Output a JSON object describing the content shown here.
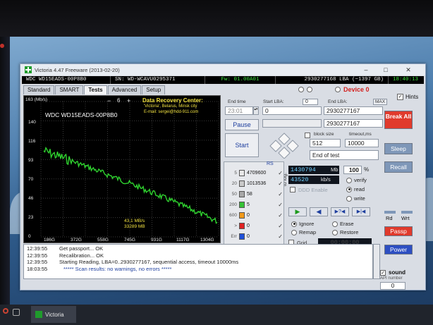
{
  "window": {
    "title": "Victoria 4.47 Freeware (2013-02-20)",
    "controls": {
      "minimize": "–",
      "maximize": "□",
      "close": "✕"
    }
  },
  "infobar": {
    "model": "WDC WD15EADS-00P8B0",
    "serial": "SN: WD-WCAVU0295371",
    "firmware": "Fw: 01.00A01",
    "lba": "2930277168 LBA (~1397 GB)",
    "time": "18:40:13"
  },
  "tabs": [
    "Standard",
    "SMART",
    "Tests",
    "Advanced",
    "Setup"
  ],
  "graph": {
    "ylabel": "163 (Mb/s)",
    "yticks": [
      "140",
      "116",
      "93",
      "70",
      "46",
      "23",
      "0"
    ],
    "xticks": [
      "186G",
      "372G",
      "558G",
      "745G",
      "931G",
      "1117G",
      "1304G"
    ],
    "minus": "−",
    "step": "6",
    "plus": "+",
    "drive_label": "WDC WD15EADS-00P8B0",
    "drc_title": "Data Recovery Center:",
    "drc_line1": "'Victoria', Belarus, Minsk city",
    "drc_line2": "E-mail: sergei@hdd-911.com",
    "speed_label": "43,1 MB/s",
    "position_label": "33289 MB",
    "line_color": "#2fd22f"
  },
  "controls": {
    "end_time_label": "End time",
    "end_time_value": "23:01",
    "start_lba_label": "Start LBA:",
    "start_lba_value": "0",
    "start_lba_small": "0",
    "end_lba_label": "End LBA:",
    "end_lba_max": "MAX",
    "end_lba_value": "2930277167",
    "current_lba_value": "2930277167",
    "pause_label": "Pause",
    "start_label": "Start",
    "block_size_label": "block size",
    "block_size_value": "512",
    "timeout_label": "timeout,ms",
    "timeout_value": "10000",
    "end_action": "End of test",
    "device_label": "Device 0",
    "hints_label": "Hints",
    "scanned_mb": "1430794",
    "scanned_unit": "Mb",
    "percent": "100",
    "percent_unit": "%",
    "speed_value": "43520",
    "speed_unit": "kb/s",
    "to_log": "to log:",
    "ddd_label": "DDD Enable",
    "mode_verify": "verify",
    "mode_read": "read",
    "mode_write": "write",
    "act_ignore": "Ignore",
    "act_erase": "Erase",
    "act_remap": "Remap",
    "act_restore": "Restore",
    "grid_label": "Grid",
    "grid_timer": "00:00:00",
    "rs_label": "RS"
  },
  "rs_stats": [
    {
      "label": "5",
      "count": "4709600",
      "color": "#e8e8e8"
    },
    {
      "label": "20",
      "count": "1013536",
      "color": "#c9c9c9"
    },
    {
      "label": "50",
      "count": "58",
      "color": "#a8a8a8"
    },
    {
      "label": "200",
      "count": "5",
      "color": "#36c236"
    },
    {
      "label": "600",
      "count": "0",
      "color": "#f19a1b"
    },
    {
      "label": ">",
      "count": "0",
      "color": "#e02323"
    },
    {
      "label": "Err",
      "count": "0",
      "color": "#2050d8"
    }
  ],
  "right_panel": {
    "break_all": "Break All",
    "sleep": "Sleep",
    "recall": "Recall",
    "rd": "Rd",
    "wrt": "Wrt",
    "passp": "Passp",
    "power": "Power",
    "sound": "sound",
    "api_number": "API number",
    "api_value": "0"
  },
  "log": [
    {
      "time": "12:39:55",
      "msg": "Get passport... OK"
    },
    {
      "time": "12:39:55",
      "msg": "Recalibration... OK"
    },
    {
      "time": "12:39:55",
      "msg": "Starting Reading, LBA=0..2930277167, sequential access, timeout 10000ms"
    },
    {
      "time": "18:03:55",
      "msg": "***** Scan results: no warnings, no errors *****"
    }
  ],
  "taskbar": {
    "app_label": "Victoria"
  }
}
